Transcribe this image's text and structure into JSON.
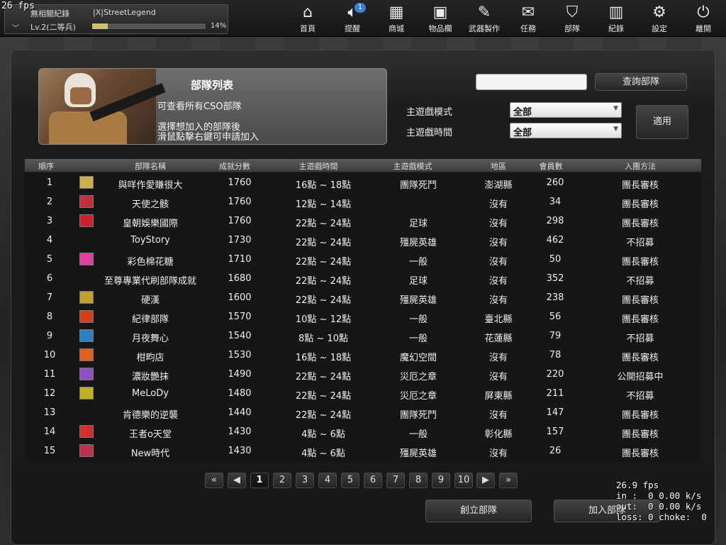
{
  "fps_top": "26 fps",
  "user": {
    "name": "無相關紀錄",
    "clan": "|X|StreetLegend",
    "level": "Lv.2(二等兵)",
    "xp_percent_label": "14%",
    "xp_fraction": 0.14
  },
  "nav": [
    {
      "label": "首頁",
      "icon": "home-icon"
    },
    {
      "label": "提醒",
      "icon": "speaker-icon",
      "badge": "1"
    },
    {
      "label": "商城",
      "icon": "shop-icon"
    },
    {
      "label": "物品欄",
      "icon": "bag-icon"
    },
    {
      "label": "武器製作",
      "icon": "weapon-icon"
    },
    {
      "label": "任務",
      "icon": "mission-icon"
    },
    {
      "label": "部隊",
      "icon": "clan-icon"
    },
    {
      "label": "紀錄",
      "icon": "stats-icon"
    },
    {
      "label": "設定",
      "icon": "gear-icon"
    },
    {
      "label": "離開",
      "icon": "power-icon"
    }
  ],
  "banner": {
    "title": "部隊列表",
    "subtitle": "可查看所有CSO部隊",
    "hint_line1": "選擇想加入的部隊後",
    "hint_line2": "滑鼠點擊右鍵可申請加入"
  },
  "search": {
    "value": "",
    "button": "查詢部隊"
  },
  "filters": {
    "mode_label": "主遊戲模式",
    "mode_value": "全部",
    "time_label": "主遊戲時間",
    "time_value": "全部",
    "apply": "適用"
  },
  "table": {
    "headers": [
      "順序",
      "部隊名稱",
      "成就分數",
      "主遊戲時間",
      "主遊戲模式",
      "地區",
      "會員數",
      "入團方法"
    ],
    "rows": [
      {
        "rank": "1",
        "name": "與咩作愛賺很大",
        "score": "1760",
        "time": "16點 ~ 18點",
        "mode": "團隊死鬥",
        "region": "澎湖縣",
        "members": "260",
        "join": "團長審核",
        "emblem": "#c8b050"
      },
      {
        "rank": "2",
        "name": "天使之骸",
        "score": "1760",
        "time": "12點 ~ 14點",
        "mode": "",
        "region": "沒有",
        "members": "34",
        "join": "團長審核",
        "emblem": "#c03040"
      },
      {
        "rank": "3",
        "name": "皇朝娛樂國際",
        "score": "1760",
        "time": "22點 ~ 24點",
        "mode": "足球",
        "region": "沒有",
        "members": "298",
        "join": "團長審核",
        "emblem": "#d02030"
      },
      {
        "rank": "4",
        "name": "ToyStory",
        "score": "1730",
        "time": "22點 ~ 24點",
        "mode": "殭屍英雄",
        "region": "沒有",
        "members": "462",
        "join": "不招募",
        "emblem": ""
      },
      {
        "rank": "5",
        "name": "彩色棉花糖",
        "score": "1710",
        "time": "22點 ~ 24點",
        "mode": "一般",
        "region": "沒有",
        "members": "50",
        "join": "團長審核",
        "emblem": "#e040a0"
      },
      {
        "rank": "6",
        "name": "至尊專業代刷部隊成就",
        "score": "1680",
        "time": "22點 ~ 24點",
        "mode": "足球",
        "region": "沒有",
        "members": "352",
        "join": "不招募",
        "emblem": ""
      },
      {
        "rank": "7",
        "name": "硬漢",
        "score": "1600",
        "time": "22點 ~ 24點",
        "mode": "殭屍英雄",
        "region": "沒有",
        "members": "238",
        "join": "團長審核",
        "emblem": "#c0a030"
      },
      {
        "rank": "8",
        "name": "紀律部隊",
        "score": "1570",
        "time": "10點 ~ 12點",
        "mode": "一般",
        "region": "臺北縣",
        "members": "56",
        "join": "團長審核",
        "emblem": "#d04020"
      },
      {
        "rank": "9",
        "name": "月夜舞心",
        "score": "1540",
        "time": "8點 ~ 10點",
        "mode": "一般",
        "region": "花蓮縣",
        "members": "79",
        "join": "不招募",
        "emblem": "#3080c0"
      },
      {
        "rank": "10",
        "name": "柑畇店",
        "score": "1530",
        "time": "16點 ~ 18點",
        "mode": "魔幻空間",
        "region": "沒有",
        "members": "78",
        "join": "團長審核",
        "emblem": "#e06020"
      },
      {
        "rank": "11",
        "name": "濃妝艷抹",
        "score": "1490",
        "time": "22點 ~ 24點",
        "mode": "災厄之章",
        "region": "沒有",
        "members": "220",
        "join": "公開招募中",
        "emblem": "#9050c0"
      },
      {
        "rank": "12",
        "name": "MeLoDy",
        "score": "1480",
        "time": "22點 ~ 24點",
        "mode": "災厄之章",
        "region": "屏東縣",
        "members": "211",
        "join": "不招募",
        "emblem": "#c0b020"
      },
      {
        "rank": "13",
        "name": "肯德樂的逆襲",
        "score": "1440",
        "time": "22點 ~ 24點",
        "mode": "團隊死鬥",
        "region": "沒有",
        "members": "147",
        "join": "團長審核",
        "emblem": ""
      },
      {
        "rank": "14",
        "name": "王者o天堂",
        "score": "1430",
        "time": "4點 ~ 6點",
        "mode": "一般",
        "region": "彰化縣",
        "members": "157",
        "join": "團長審核",
        "emblem": "#d03030"
      },
      {
        "rank": "15",
        "name": "New時代",
        "score": "1430",
        "time": "4點 ~ 6點",
        "mode": "殭屍英雄",
        "region": "沒有",
        "members": "26",
        "join": "團長審核",
        "emblem": "#c03050"
      }
    ]
  },
  "pagination": {
    "first": "«",
    "prev": "◀",
    "pages": [
      "1",
      "2",
      "3",
      "4",
      "5",
      "6",
      "7",
      "8",
      "9",
      "10"
    ],
    "next": "▶",
    "last": "»",
    "current": "1"
  },
  "actions": {
    "create": "創立部隊",
    "join": "加入部隊"
  },
  "netinfo": {
    "fps": "26.9 fps",
    "in": "in :  0 0.00 k/s",
    "out": "out:  0 0.00 k/s",
    "loss": "loss: 0 choke:  0"
  }
}
